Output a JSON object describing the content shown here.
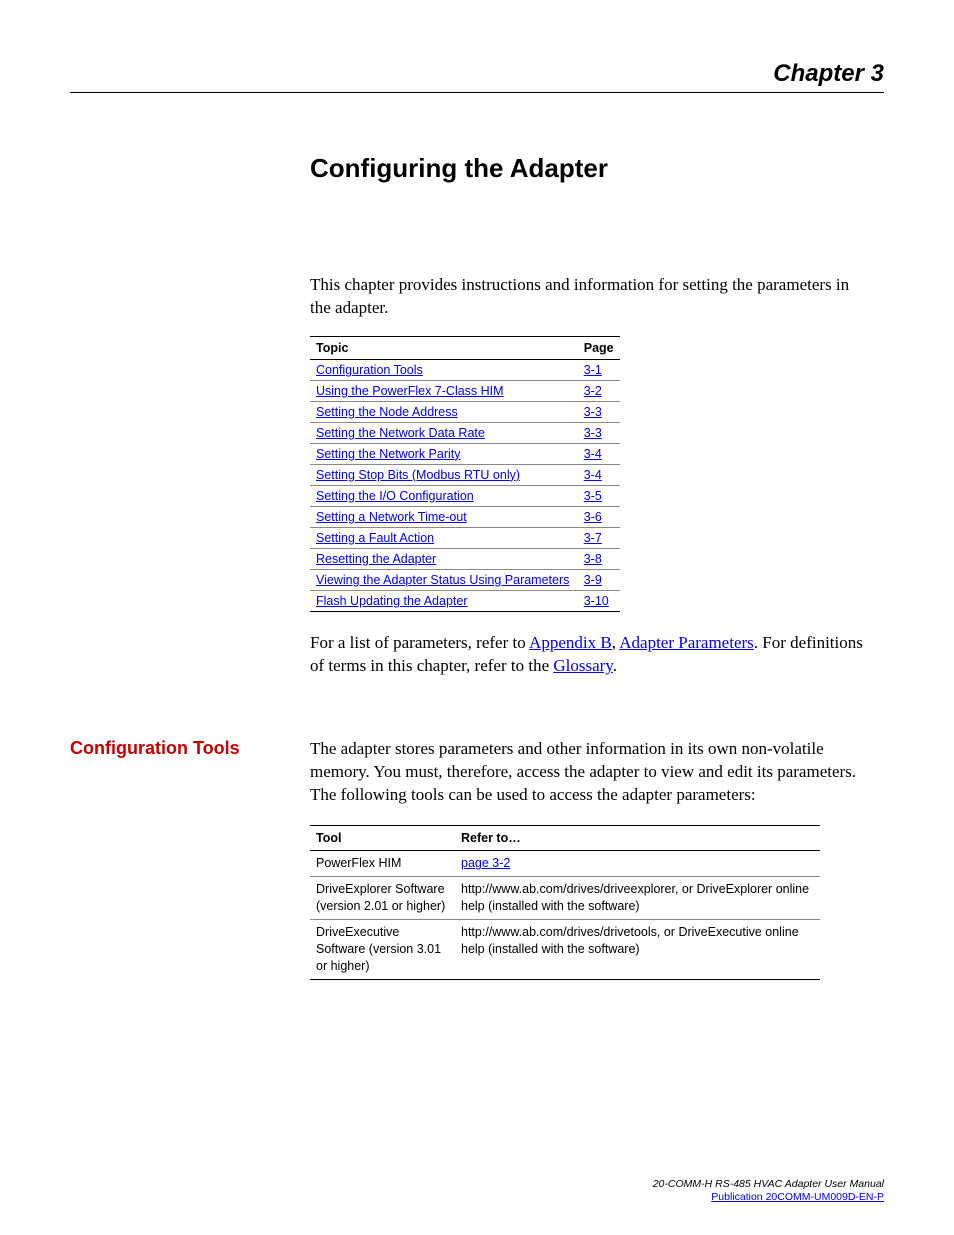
{
  "header": {
    "chapter": "Chapter 3",
    "title": "Configuring the Adapter"
  },
  "intro": "This chapter provides instructions and information for setting the parameters in the adapter.",
  "topics_table": {
    "col_topic": "Topic",
    "col_page": "Page",
    "rows": [
      {
        "topic": "Configuration Tools",
        "page": "3-1"
      },
      {
        "topic": "Using the PowerFlex 7-Class HIM",
        "page": "3-2"
      },
      {
        "topic": "Setting the Node Address",
        "page": "3-3"
      },
      {
        "topic": "Setting the Network Data Rate",
        "page": "3-3"
      },
      {
        "topic": "Setting the Network Parity",
        "page": "3-4"
      },
      {
        "topic": "Setting Stop Bits (Modbus RTU only)",
        "page": "3-4"
      },
      {
        "topic": "Setting the I/O Configuration",
        "page": "3-5"
      },
      {
        "topic": "Setting a Network Time-out",
        "page": "3-6"
      },
      {
        "topic": "Setting a Fault Action",
        "page": "3-7"
      },
      {
        "topic": "Resetting the Adapter",
        "page": "3-8"
      },
      {
        "topic": "Viewing the Adapter Status Using Parameters",
        "page": "3-9"
      },
      {
        "topic": "Flash Updating the Adapter",
        "page": "3-10"
      }
    ]
  },
  "after_table": {
    "pre1": "For a list of parameters, refer to ",
    "link1": "Appendix B",
    "sep1": ", ",
    "link2": "Adapter Parameters",
    "post1": ". For definitions of terms in this chapter, refer to the ",
    "link3": "Glossary",
    "post2": "."
  },
  "section": {
    "heading": "Configuration Tools",
    "body": "The adapter stores parameters and other information in its own non-volatile memory. You must, therefore, access the adapter to view and edit its parameters. The following tools can be used to access the adapter parameters:"
  },
  "tools_table": {
    "col_tool": "Tool",
    "col_refer": "Refer to…",
    "rows": [
      {
        "tool": "PowerFlex HIM",
        "refer_link": "page 3-2",
        "refer_text": ""
      },
      {
        "tool": "DriveExplorer Software (version 2.01 or higher)",
        "refer_link": "",
        "refer_text": "http://www.ab.com/drives/driveexplorer, or DriveExplorer online help (installed with the software)"
      },
      {
        "tool": "DriveExecutive Software (version 3.01 or higher)",
        "refer_link": "",
        "refer_text": "http://www.ab.com/drives/drivetools, or DriveExecutive online help (installed with the software)"
      }
    ]
  },
  "footer": {
    "doc": "20-COMM-H RS-485 HVAC Adapter User Manual",
    "pub": "Publication 20COMM-UM009D-EN-P"
  }
}
